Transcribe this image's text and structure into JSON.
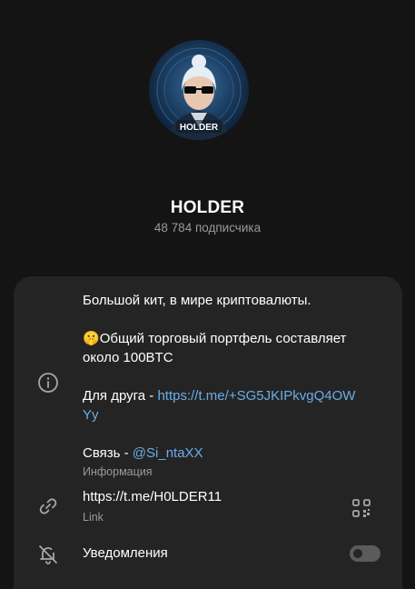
{
  "header": {
    "title": "HOLDER",
    "subscribers": "48 784 подписчика",
    "avatar_text": "HOLDER"
  },
  "info": {
    "line1": "Большой кит, в мире криптовалюты.",
    "emoji": "🤫",
    "line2a": "Общий торговый портфель составляет",
    "line2b": "около 100BTC",
    "friend_prefix": "Для друга - ",
    "friend_link_a": "https://t.me/+SG5JKIPkvgQ4OW",
    "friend_link_b": "Yy",
    "contact_prefix": "Связь - ",
    "contact_link": "@Si_ntaXX",
    "label": "Информация"
  },
  "link": {
    "url": "https://t.me/H0LDER11",
    "label": "Link"
  },
  "notifications": {
    "label": "Уведомления",
    "enabled": false
  },
  "icons": {
    "info": "info-icon",
    "link": "link-icon",
    "qr": "qr-code-icon",
    "bell_off": "bell-off-icon"
  },
  "colors": {
    "background": "#141414",
    "card": "#242424",
    "link": "#6aaee8",
    "secondary_text": "#9a9a9a"
  }
}
